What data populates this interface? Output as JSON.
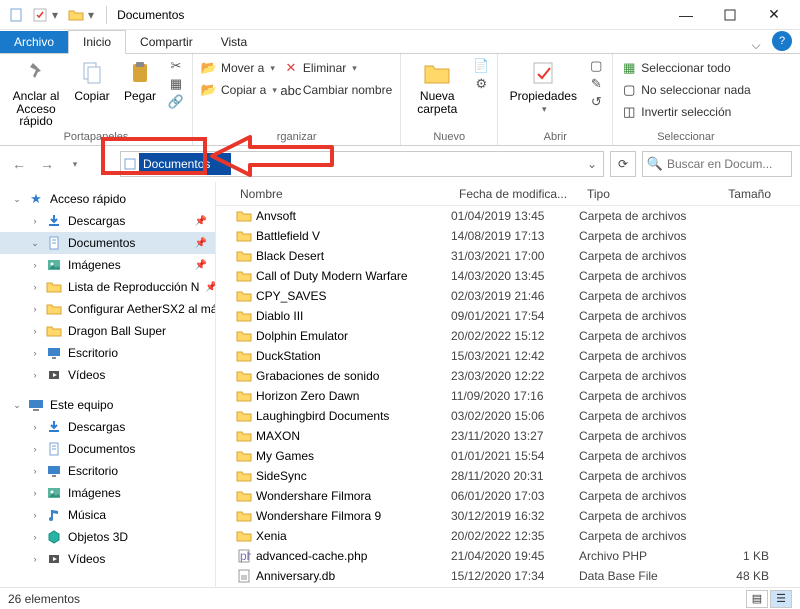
{
  "window": {
    "title": "Documentos"
  },
  "tabs_row": {
    "file": "Archivo",
    "tabs": [
      "Inicio",
      "Compartir",
      "Vista"
    ],
    "active": 0
  },
  "ribbon": {
    "clip": {
      "label": "Portapapeles",
      "pin": "Anclar al\nAcceso rápido",
      "copy": "Copiar",
      "paste": "Pegar"
    },
    "org": {
      "label": "rganizar",
      "move": "Mover a",
      "copyto": "Copiar a",
      "delete": "Eliminar",
      "rename": "Cambiar nombre"
    },
    "new": {
      "label": "Nuevo",
      "newfolder": "Nueva\ncarpeta"
    },
    "open": {
      "label": "Abrir",
      "properties": "Propiedades"
    },
    "select": {
      "label": "Seleccionar",
      "all": "Seleccionar todo",
      "none": "No seleccionar nada",
      "invert": "Invertir selección"
    }
  },
  "address": {
    "value": "Documentos"
  },
  "search": {
    "placeholder": "Buscar en Docum..."
  },
  "nav": {
    "quick": {
      "label": "Acceso rápido",
      "items": [
        {
          "icon": "download",
          "label": "Descargas",
          "pin": true
        },
        {
          "icon": "document",
          "label": "Documentos",
          "pin": true,
          "selected": true
        },
        {
          "icon": "picture",
          "label": "Imágenes",
          "pin": true
        },
        {
          "icon": "folder",
          "label": "Lista de Reproducción N",
          "pin": true
        },
        {
          "icon": "folder",
          "label": "Configurar AetherSX2 al má",
          "pin": false
        },
        {
          "icon": "folder",
          "label": "Dragon Ball Super",
          "pin": false
        },
        {
          "icon": "desktop",
          "label": "Escritorio",
          "pin": false
        },
        {
          "icon": "video",
          "label": "Vídeos",
          "pin": false
        }
      ]
    },
    "pc": {
      "label": "Este equipo",
      "items": [
        {
          "icon": "download",
          "label": "Descargas"
        },
        {
          "icon": "document",
          "label": "Documentos"
        },
        {
          "icon": "desktop",
          "label": "Escritorio"
        },
        {
          "icon": "picture",
          "label": "Imágenes"
        },
        {
          "icon": "music",
          "label": "Música"
        },
        {
          "icon": "objects3d",
          "label": "Objetos 3D"
        },
        {
          "icon": "video",
          "label": "Vídeos"
        }
      ]
    }
  },
  "cols": {
    "name": "Nombre",
    "date": "Fecha de modifica...",
    "type": "Tipo",
    "size": "Tamaño"
  },
  "files": [
    {
      "icon": "folder",
      "name": "Anvsoft",
      "date": "01/04/2019 13:45",
      "type": "Carpeta de archivos",
      "size": ""
    },
    {
      "icon": "folder",
      "name": "Battlefield V",
      "date": "14/08/2019 17:13",
      "type": "Carpeta de archivos",
      "size": ""
    },
    {
      "icon": "folder",
      "name": "Black Desert",
      "date": "31/03/2021 17:00",
      "type": "Carpeta de archivos",
      "size": ""
    },
    {
      "icon": "folder",
      "name": "Call of Duty Modern Warfare",
      "date": "14/03/2020 13:45",
      "type": "Carpeta de archivos",
      "size": ""
    },
    {
      "icon": "folder",
      "name": "CPY_SAVES",
      "date": "02/03/2019 21:46",
      "type": "Carpeta de archivos",
      "size": ""
    },
    {
      "icon": "folder",
      "name": "Diablo III",
      "date": "09/01/2021 17:54",
      "type": "Carpeta de archivos",
      "size": ""
    },
    {
      "icon": "folder",
      "name": "Dolphin Emulator",
      "date": "20/02/2022 15:12",
      "type": "Carpeta de archivos",
      "size": ""
    },
    {
      "icon": "folder",
      "name": "DuckStation",
      "date": "15/03/2021 12:42",
      "type": "Carpeta de archivos",
      "size": ""
    },
    {
      "icon": "folder",
      "name": "Grabaciones de sonido",
      "date": "23/03/2020 12:22",
      "type": "Carpeta de archivos",
      "size": ""
    },
    {
      "icon": "folder",
      "name": "Horizon Zero Dawn",
      "date": "11/09/2020 17:16",
      "type": "Carpeta de archivos",
      "size": ""
    },
    {
      "icon": "folder",
      "name": "Laughingbird Documents",
      "date": "03/02/2020 15:06",
      "type": "Carpeta de archivos",
      "size": ""
    },
    {
      "icon": "folder",
      "name": "MAXON",
      "date": "23/11/2020 13:27",
      "type": "Carpeta de archivos",
      "size": ""
    },
    {
      "icon": "folder",
      "name": "My Games",
      "date": "01/01/2021 15:54",
      "type": "Carpeta de archivos",
      "size": ""
    },
    {
      "icon": "folder",
      "name": "SideSync",
      "date": "28/11/2020 20:31",
      "type": "Carpeta de archivos",
      "size": ""
    },
    {
      "icon": "folder",
      "name": "Wondershare Filmora",
      "date": "06/01/2020 17:03",
      "type": "Carpeta de archivos",
      "size": ""
    },
    {
      "icon": "folder",
      "name": "Wondershare Filmora 9",
      "date": "30/12/2019 16:32",
      "type": "Carpeta de archivos",
      "size": ""
    },
    {
      "icon": "folder",
      "name": "Xenia",
      "date": "20/02/2022 12:35",
      "type": "Carpeta de archivos",
      "size": ""
    },
    {
      "icon": "php",
      "name": "advanced-cache.php",
      "date": "21/04/2020 19:45",
      "type": "Archivo PHP",
      "size": "1 KB"
    },
    {
      "icon": "db",
      "name": "Anniversary.db",
      "date": "15/12/2020 17:34",
      "type": "Data Base File",
      "size": "48 KB"
    }
  ],
  "status": {
    "count": "26 elementos"
  }
}
